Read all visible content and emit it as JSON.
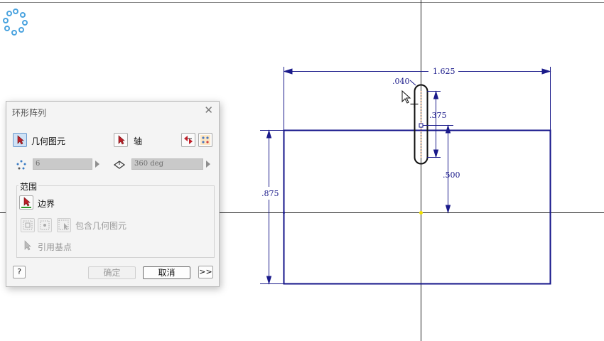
{
  "canvas": {
    "dimensions": {
      "top_width": "1.625",
      "slot_width": ".040",
      "slot_length": ".375",
      "slot_offset": ".500",
      "rect_height": ".875"
    }
  },
  "dialog": {
    "title": "环形阵列",
    "geometry_label": "几何图元",
    "axis_label": "轴",
    "count_value": "6",
    "angle_value": "360 deg",
    "range_group": "范围",
    "boundary_label": "边界",
    "include_geometry_label": "包含几何图元",
    "reference_point_label": "引用基点",
    "ok_label": "确定",
    "cancel_label": "取消",
    "more_label": ">>",
    "help_label": "?"
  },
  "colors": {
    "sketch_blue": "#14148a",
    "dimension_blue": "#1a1a8a",
    "axis_line": "#222222",
    "busy_spinner": "#4aa3df",
    "center_point": "#f0e000"
  }
}
